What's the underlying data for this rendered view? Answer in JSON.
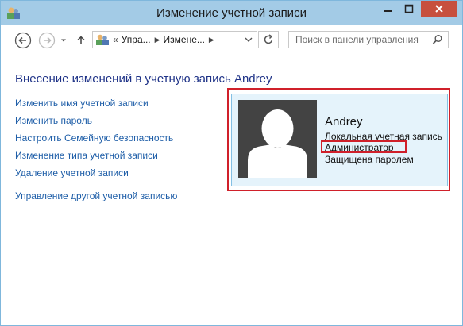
{
  "window": {
    "title": "Изменение учетной записи"
  },
  "navigation": {
    "breadcrumb_chevron": "«",
    "breadcrumbs": [
      "Упра...",
      "Измене..."
    ],
    "search_placeholder": "Поиск в панели управления"
  },
  "main": {
    "heading": "Внесение изменений в учетную запись Andrey",
    "links": [
      "Изменить имя учетной записи",
      "Изменить пароль",
      "Настроить Семейную безопасность",
      "Изменение типа учетной записи",
      "Удаление учетной записи"
    ],
    "other_link": "Управление другой учетной записью"
  },
  "account": {
    "name": "Andrey",
    "type": "Локальная учетная запись",
    "role": "Администратор",
    "protection": "Защищена паролем"
  },
  "colors": {
    "titlebar": "#a3cbe6",
    "close_button": "#c7503e",
    "link": "#1e5ea8",
    "heading": "#1e3287",
    "card_bg": "#e5f3fb",
    "highlight": "#d0202a",
    "avatar_bg": "#434343"
  },
  "icons": {
    "app": "control-panel-users-icon",
    "back": "back-arrow-icon",
    "forward": "forward-arrow-icon",
    "recent": "chevron-down-icon",
    "up": "up-arrow-icon",
    "refresh": "refresh-icon",
    "search": "search-icon"
  }
}
